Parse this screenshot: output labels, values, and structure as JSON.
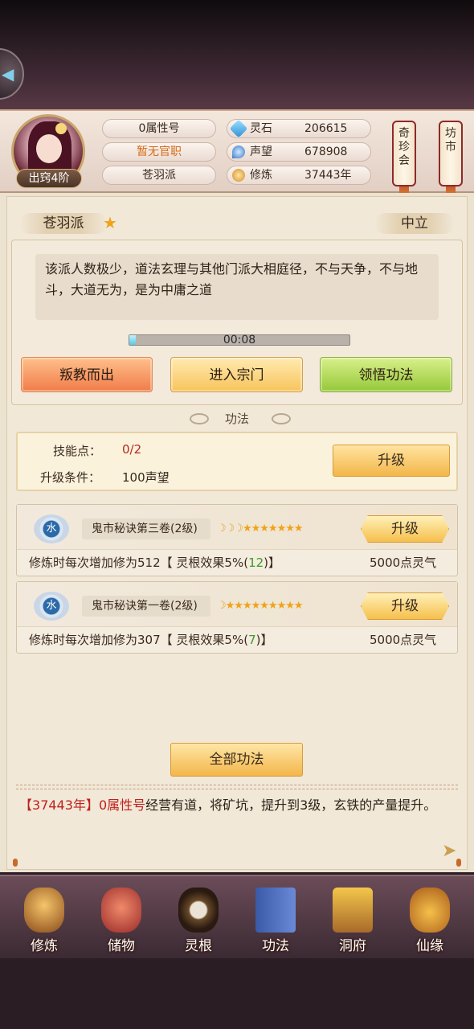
{
  "header": {
    "rank_badge": "出窍4阶",
    "attribute_title": "0属性号",
    "official_post": "暂无官职",
    "sect": "苍羽派",
    "stats": [
      {
        "icon": "spirit-stone-icon",
        "label": "灵石",
        "value": "206615"
      },
      {
        "icon": "reputation-icon",
        "label": "声望",
        "value": "678908"
      },
      {
        "icon": "cultivation-icon",
        "label": "修炼",
        "value": "37443年"
      }
    ],
    "side_buttons": {
      "qizhen": "奇珍会",
      "fangshi": "坊市"
    }
  },
  "sect_panel": {
    "name": "苍羽派",
    "stance": "中立",
    "description": "该派人数极少，道法玄理与其他门派大相庭径，不与天争，不与地斗，大道无为，是为中庸之道",
    "timer": "00:08",
    "progress": 0.03,
    "buttons": {
      "leave": "叛教而出",
      "enter": "进入宗门",
      "learn": "领悟功法"
    }
  },
  "gongfa": {
    "title": "功法",
    "skill_points_label": "技能点：",
    "skill_points_value": "0/2",
    "upgrade_cond_label": "升级条件：",
    "upgrade_cond_value": "100声望",
    "upgrade_button": "升级",
    "skills": [
      {
        "element": "水",
        "name": "鬼市秘诀第三卷(2级)",
        "moons": "☽☽☽",
        "stars": "★★★★★★★",
        "effect_prefix": "修炼时每次增加修为512【 灵根效果5%(",
        "effect_bonus": "12",
        "effect_suffix": ")】",
        "cost": "5000点灵气",
        "upgrade": "升级"
      },
      {
        "element": "水",
        "name": "鬼市秘诀第一卷(2级)",
        "moons": "☽",
        "stars": "★★★★★★★★★",
        "effect_prefix": "修炼时每次增加修为307【 灵根效果5%(",
        "effect_bonus": "7",
        "effect_suffix": ")】",
        "cost": "5000点灵气",
        "upgrade": "升级"
      }
    ],
    "all_button": "全部功法"
  },
  "log": {
    "open1": "【",
    "year": "37443年",
    "close1": "】",
    "name": "0属性号",
    "text": "经营有道，将矿坑，提升到3级，玄铁的产量提升。"
  },
  "nav": [
    {
      "label": "修炼"
    },
    {
      "label": "储物"
    },
    {
      "label": "灵根"
    },
    {
      "label": "功法"
    },
    {
      "label": "洞府"
    },
    {
      "label": "仙缘"
    }
  ],
  "colors": {
    "accent_orange": "#d46a16",
    "red_text": "#c0201c",
    "green_text": "#3a9a2a"
  }
}
